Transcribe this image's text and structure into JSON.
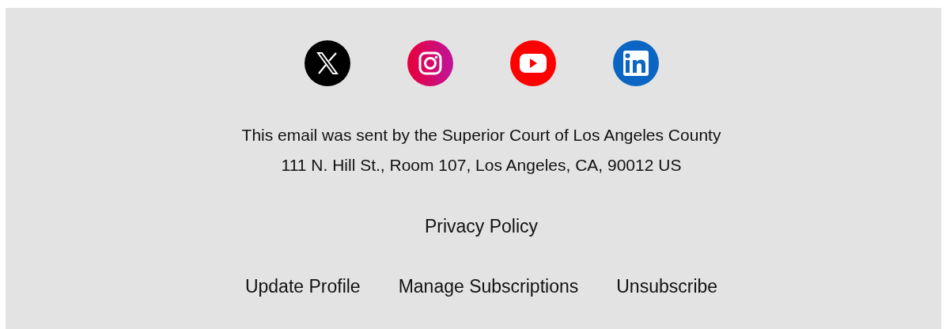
{
  "social_links": [
    {
      "kind": "x"
    },
    {
      "kind": "instagram"
    },
    {
      "kind": "youtube"
    },
    {
      "kind": "linkedin"
    }
  ],
  "footer_text": [
    "This email was sent by the Superior Court of Los Angeles County",
    "111 N. Hill St., Room 107, Los Angeles, CA, 90012 US"
  ],
  "privacy_link": "Privacy Policy",
  "links": [
    "Update Profile",
    "Manage Subscriptions",
    "Unsubscribe"
  ]
}
